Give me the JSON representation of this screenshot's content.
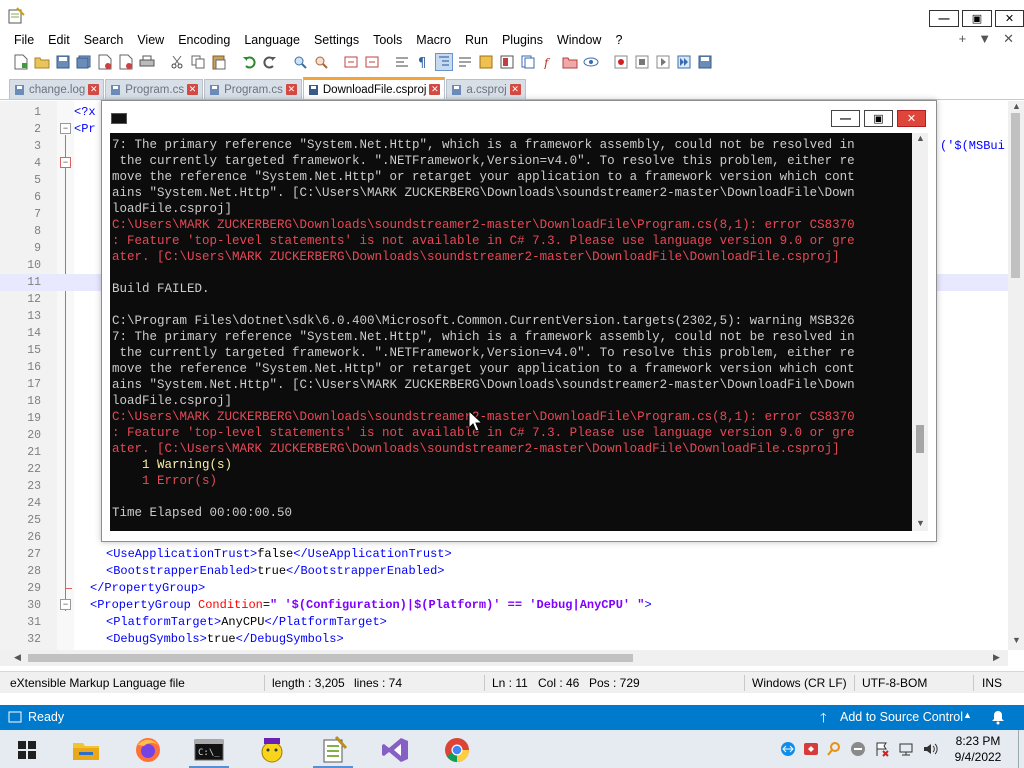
{
  "menu": [
    "File",
    "Edit",
    "Search",
    "View",
    "Encoding",
    "Language",
    "Settings",
    "Tools",
    "Macro",
    "Run",
    "Plugins",
    "Window",
    "?"
  ],
  "menu_right": [
    "+",
    "▼",
    "✕"
  ],
  "tabs": [
    {
      "label": "change.log",
      "active": false
    },
    {
      "label": "Program.cs",
      "active": false
    },
    {
      "label": "Program.cs",
      "active": false
    },
    {
      "label": "DownloadFile.csproj",
      "active": true
    },
    {
      "label": "a.csproj",
      "active": false
    }
  ],
  "editor": {
    "line_numbers": [
      "1",
      "2",
      "3",
      "4",
      "5",
      "6",
      "7",
      "8",
      "9",
      "10",
      "11",
      "12",
      "13",
      "14",
      "15",
      "16",
      "17",
      "18",
      "19",
      "20",
      "21",
      "22",
      "23",
      "24",
      "25",
      "26",
      "27",
      "28",
      "29",
      "30",
      "31",
      "32"
    ],
    "line1_visible": "<?x",
    "line2_visible": "<Pr",
    "line3_right_fragment": "('$(MSBui",
    "line27": {
      "open": "<UseApplicationTrust>",
      "text": "false",
      "close": "</UseApplicationTrust>"
    },
    "line28": {
      "open": "<BootstrapperEnabled>",
      "text": "true",
      "close": "</BootstrapperEnabled>"
    },
    "line29": {
      "close": "</PropertyGroup>"
    },
    "line30": {
      "open": "<PropertyGroup",
      "attr": " Condition",
      "eq": "=",
      "val": "\" '$(Configuration)|$(Platform)' == 'Debug|AnyCPU' \"",
      "end": ">"
    },
    "line31": {
      "open": "<PlatformTarget>",
      "text": "AnyCPU",
      "close": "</PlatformTarget>"
    },
    "line32": {
      "open": "<DebugSymbols>",
      "text": "true",
      "close": "</DebugSymbols>"
    }
  },
  "statusbar": {
    "file_type": "eXtensible Markup Language file",
    "length": "length : 3,205",
    "lines": "lines : 74",
    "ln": "Ln : 11",
    "col": "Col : 46",
    "pos": "Pos : 729",
    "eol": "Windows (CR LF)",
    "encoding": "UTF-8-BOM",
    "mode": "INS"
  },
  "vs_strip": {
    "status": "Ready",
    "source_control": "Add to Source Control"
  },
  "console": {
    "lines": [
      {
        "text": "7: The primary reference \"System.Net.Http\", which is a framework assembly, could not be resolved in",
        "kind": "normal"
      },
      {
        "text": " the currently targeted framework. \".NETFramework,Version=v4.0\". To resolve this problem, either re",
        "kind": "normal"
      },
      {
        "text": "move the reference \"System.Net.Http\" or retarget your application to a framework version which cont",
        "kind": "normal"
      },
      {
        "text": "ains \"System.Net.Http\". [C:\\Users\\MARK ZUCKERBERG\\Downloads\\soundstreamer2-master\\DownloadFile\\Down",
        "kind": "normal"
      },
      {
        "text": "loadFile.csproj]",
        "kind": "normal"
      },
      {
        "text": "C:\\Users\\MARK ZUCKERBERG\\Downloads\\soundstreamer2-master\\DownloadFile\\Program.cs(8,1): error CS8370",
        "kind": "err"
      },
      {
        "text": ": Feature 'top-level statements' is not available in C# 7.3. Please use language version 9.0 or gre",
        "kind": "err"
      },
      {
        "text": "ater. [C:\\Users\\MARK ZUCKERBERG\\Downloads\\soundstreamer2-master\\DownloadFile\\DownloadFile.csproj]",
        "kind": "err"
      },
      {
        "text": "",
        "kind": "normal"
      },
      {
        "text": "Build FAILED.",
        "kind": "normal"
      },
      {
        "text": "",
        "kind": "normal"
      },
      {
        "text": "C:\\Program Files\\dotnet\\sdk\\6.0.400\\Microsoft.Common.CurrentVersion.targets(2302,5): warning MSB326",
        "kind": "normal"
      },
      {
        "text": "7: The primary reference \"System.Net.Http\", which is a framework assembly, could not be resolved in",
        "kind": "normal"
      },
      {
        "text": " the currently targeted framework. \".NETFramework,Version=v4.0\". To resolve this problem, either re",
        "kind": "normal"
      },
      {
        "text": "move the reference \"System.Net.Http\" or retarget your application to a framework version which cont",
        "kind": "normal"
      },
      {
        "text": "ains \"System.Net.Http\". [C:\\Users\\MARK ZUCKERBERG\\Downloads\\soundstreamer2-master\\DownloadFile\\Down",
        "kind": "normal"
      },
      {
        "text": "loadFile.csproj]",
        "kind": "normal"
      },
      {
        "text": "C:\\Users\\MARK ZUCKERBERG\\Downloads\\soundstreamer2-master\\DownloadFile\\Program.cs(8,1): error CS8370",
        "kind": "err"
      },
      {
        "text": ": Feature 'top-level statements' is not available in C# 7.3. Please use language version 9.0 or gre",
        "kind": "err"
      },
      {
        "text": "ater. [C:\\Users\\MARK ZUCKERBERG\\Downloads\\soundstreamer2-master\\DownloadFile\\DownloadFile.csproj]",
        "kind": "err"
      },
      {
        "text": "    1 Warning(s)",
        "kind": "warn"
      },
      {
        "text": "    1 Error(s)",
        "kind": "err"
      },
      {
        "text": "",
        "kind": "normal"
      },
      {
        "text": "Time Elapsed 00:00:00.50",
        "kind": "normal"
      }
    ]
  },
  "taskbar": {
    "time": "8:23 PM",
    "date": "9/4/2022"
  },
  "colors": {
    "accent_tab": "#f4a437",
    "vs_blue": "#007acc",
    "console_bg": "#0c0c0c",
    "console_err": "#e74856",
    "console_warn": "#f9f1a5"
  }
}
